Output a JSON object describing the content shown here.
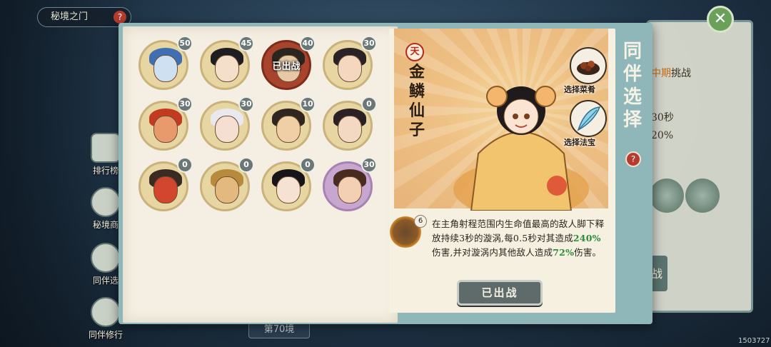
{
  "header": {
    "title": "秘境之门",
    "help_icon": "?"
  },
  "side_nav": [
    {
      "label": "排行榜",
      "icon": "ranking-icon"
    },
    {
      "label": "秘境商",
      "icon": "shop-icon"
    },
    {
      "label": "同伴选",
      "icon": "companion-select-icon"
    },
    {
      "label": "同伴修行",
      "icon": "companion-training-icon"
    }
  ],
  "background": {
    "challenge_prefix": "中期",
    "challenge_suffix": "挑战",
    "time_text": "30秒",
    "percent_text": "20%",
    "button_text": "战",
    "stage_label": "第70境",
    "uid": "1503727"
  },
  "companions": [
    {
      "level": "50",
      "hair": "#3f6fb2",
      "skin": "#cfe0f2"
    },
    {
      "level": "45",
      "hair": "#1e1e22",
      "skin": "#f4dfca"
    },
    {
      "level": "40",
      "hair": "#2b2520",
      "skin": "#e8c9a5",
      "selected": true,
      "tag": "已出战"
    },
    {
      "level": "30",
      "hair": "#2a2226",
      "skin": "#f5d7bf"
    },
    {
      "level": "30",
      "hair": "#c23a1f",
      "skin": "#e89a6c"
    },
    {
      "level": "30",
      "hair": "#e8e8ee",
      "skin": "#f4dfd0"
    },
    {
      "level": "10",
      "hair": "#2f2620",
      "skin": "#f0cfa7"
    },
    {
      "level": "0",
      "hair": "#2b2024",
      "skin": "#f3d9c2"
    },
    {
      "level": "0",
      "hair": "#3a2a22",
      "skin": "#d2452e"
    },
    {
      "level": "0",
      "hair": "#b88a3c",
      "skin": "#e4b980"
    },
    {
      "level": "0",
      "hair": "#171519",
      "skin": "#f6e2d2"
    },
    {
      "level": "30",
      "hair": "#4a2b1f",
      "skin": "#f3d0b4",
      "purple": true
    }
  ],
  "detail": {
    "tier_badge": "天",
    "name_chars": [
      "金",
      "鳞",
      "仙",
      "子"
    ],
    "equip": [
      {
        "label": "选择菜肴",
        "icon": "dish-icon"
      },
      {
        "label": "选择法宝",
        "icon": "feather-treasure-icon"
      }
    ],
    "skill_level": "6",
    "skill_parts": {
      "p1": "在主角射程范围内生命值最高的敌人脚下释放持续3秒的漩涡,每0.5秒对其造成",
      "v1": "240%",
      "p2": "伤害,并对漩涡内其他敌人造成",
      "v2": "72%",
      "p3": "伤害。"
    },
    "deploy_button": "已出战"
  },
  "side_title_chars": [
    "同",
    "伴",
    "选",
    "择"
  ],
  "colors": {
    "highlight": "#2d8b3a",
    "help": "#b53b2e",
    "dialog_frame": "#8fb7b9"
  }
}
